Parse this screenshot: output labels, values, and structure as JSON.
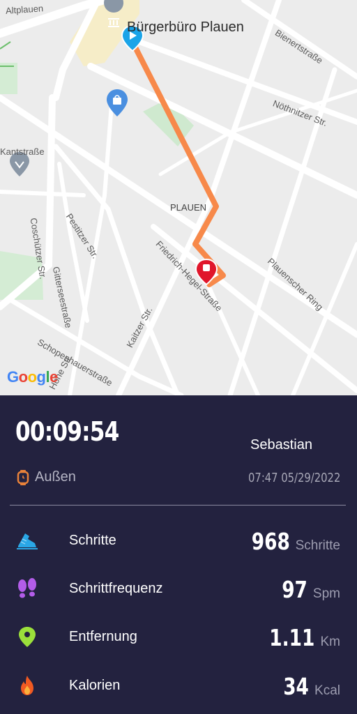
{
  "map": {
    "pois": {
      "buergerbuero": "Bürgerbüro Plauen",
      "plauen": "PLAUEN"
    },
    "streets": {
      "altplauen": "Altplauen",
      "bienertstrasse": "Bienertstraße",
      "noethnitzer": "Nöthnitzer Str.",
      "kantstrasse": "Kantstraße",
      "coschuetzer": "Coschützer Str.",
      "pestitzer": "Pestitzer Str.",
      "gittersee": "Gitterseestraße",
      "friedrich_hegel": "Friedrich-Hegel-Straße",
      "plauenscher_ring": "Plauenscher Ring",
      "schopenhauer": "Schopenhauerstraße",
      "kaitzer": "Kaitzer Str.",
      "hohe": "Hohe Str."
    },
    "attribution": {
      "g1": "G",
      "o1": "o",
      "o2": "o",
      "g2": "g",
      "l": "l",
      "e": "e"
    },
    "colors": {
      "route": "#f7894a",
      "start": "#1aa4e8",
      "end": "#e0162b"
    }
  },
  "workout": {
    "duration": "00:09:54",
    "user": "Sebastian",
    "location": "Außen",
    "datetime": "07:47 05/29/2022"
  },
  "stats": [
    {
      "label": "Schritte",
      "value": "968",
      "unit": "Schritte",
      "icon": "shoe-icon"
    },
    {
      "label": "Schrittfrequenz",
      "value": "97",
      "unit": "Spm",
      "icon": "footprints-icon"
    },
    {
      "label": "Entfernung",
      "value": "1.11",
      "unit": "Km",
      "icon": "location-pin-icon"
    },
    {
      "label": "Kalorien",
      "value": "34",
      "unit": "Kcal",
      "icon": "flame-icon"
    }
  ]
}
